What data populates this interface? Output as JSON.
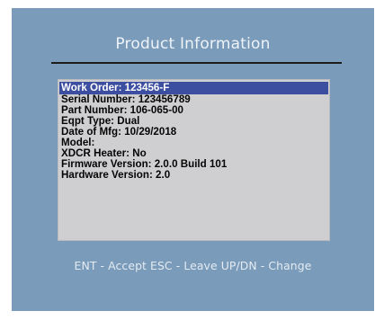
{
  "screen": {
    "title": "Product Information",
    "colors": {
      "background": "#7a9bba",
      "info_box": "#cfcfd1",
      "selection": "#3c4ea0"
    },
    "info_items": [
      {
        "label": "Work Order: 123456-F",
        "selected": true
      },
      {
        "label": "Serial Number: 123456789",
        "selected": false
      },
      {
        "label": "Part Number: 106-065-00",
        "selected": false
      },
      {
        "label": "Eqpt Type: Dual",
        "selected": false
      },
      {
        "label": "Date of Mfg: 10/29/2018",
        "selected": false
      },
      {
        "label": "Model:",
        "selected": false
      },
      {
        "label": "XDCR Heater: No",
        "selected": false
      },
      {
        "label": "Firmware Version: 2.0.0 Build 101",
        "selected": false
      },
      {
        "label": "Hardware Version: 2.0",
        "selected": false
      }
    ],
    "footer_hint": "ENT - Accept ESC - Leave UP/DN - Change"
  }
}
